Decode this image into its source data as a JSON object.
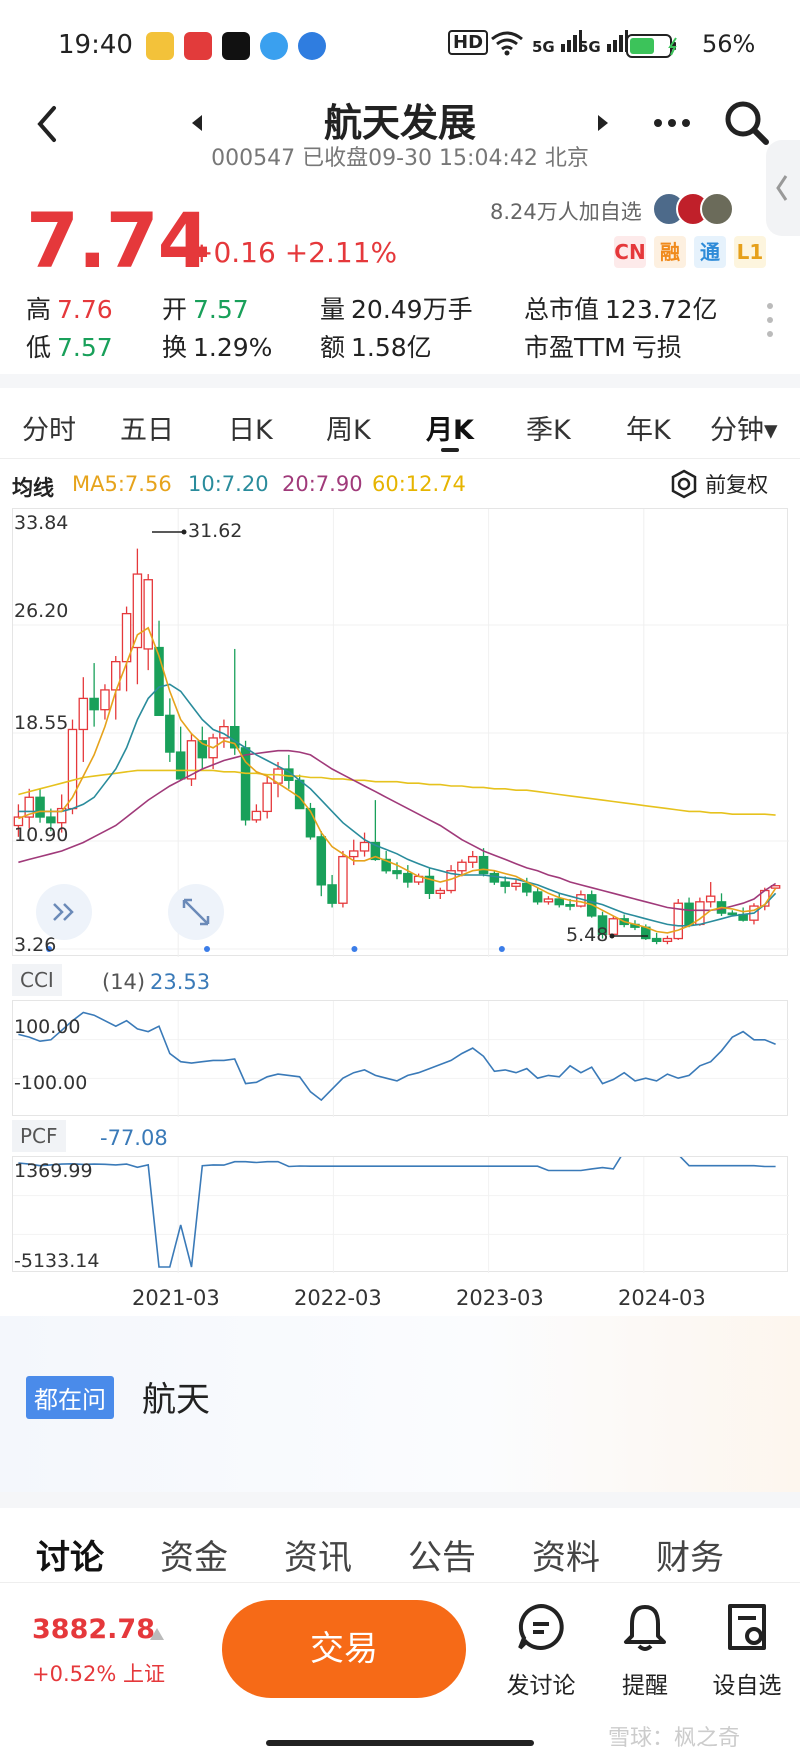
{
  "status_bar": {
    "time": "19:40",
    "battery": "56%",
    "hd": "HD",
    "net1": "5G",
    "net2": "5G"
  },
  "header": {
    "title": "航天发展",
    "subtitle": "000547 已收盘09-30 15:04:42 北京",
    "price": "7.74",
    "change": "+0.16 +2.11%",
    "watchers": "8.24万人加自选",
    "tags": [
      "CN",
      "融",
      "通",
      "L1"
    ]
  },
  "quote": {
    "high_label": "高",
    "high": "7.76",
    "low_label": "低",
    "low": "7.57",
    "open_label": "开",
    "open": "7.57",
    "turnover_label": "换",
    "turnover": "1.29%",
    "volume_label": "量",
    "volume": "20.49万手",
    "amount_label": "额",
    "amount": "1.58亿",
    "mktcap_label": "总市值",
    "mktcap": "123.72亿",
    "pe_label": "市盈TTM",
    "pe": "亏损"
  },
  "period_tabs": [
    "分时",
    "五日",
    "日K",
    "周K",
    "月K",
    "季K",
    "年K",
    "分钟▾"
  ],
  "active_period": "月K",
  "ma_legend": {
    "label": "均线",
    "ma5": "MA5:7.56",
    "ma10": "10:7.20",
    "ma20": "20:7.90",
    "ma60": "60:12.74",
    "adjust": "前复权"
  },
  "colors": {
    "up": "#e5383b",
    "down": "#19a05a",
    "ma5": "#e6a31c",
    "ma10": "#2a8c9c",
    "ma20": "#a03a7a",
    "ma60": "#e6c21e",
    "indicator": "#3a7ab8",
    "trade_btn": "#f66a17"
  },
  "chart_data": [
    {
      "type": "candlestick",
      "title": "月K",
      "y_ticks": [
        "33.84",
        "26.20",
        "18.55",
        "10.90",
        "3.26"
      ],
      "ylim": [
        3.26,
        33.84
      ],
      "x_ticks": [
        "2021-03",
        "2022-03",
        "2023-03",
        "2024-03"
      ],
      "annotations": {
        "max": "31.62",
        "min": "5.48"
      },
      "ohlc": [
        [
          12.0,
          13.5,
          11.2,
          12.6
        ],
        [
          12.6,
          14.6,
          11.8,
          14.0
        ],
        [
          14.0,
          14.6,
          12.2,
          12.6
        ],
        [
          12.6,
          13.2,
          11.6,
          12.2
        ],
        [
          12.2,
          14.2,
          11.5,
          13.2
        ],
        [
          13.2,
          19.5,
          12.8,
          18.8
        ],
        [
          18.8,
          22.5,
          16.5,
          21.0
        ],
        [
          21.0,
          23.5,
          19.0,
          20.2
        ],
        [
          20.2,
          22.0,
          19.5,
          21.6
        ],
        [
          21.6,
          24.0,
          19.5,
          23.6
        ],
        [
          23.6,
          27.5,
          21.5,
          27.0
        ],
        [
          24.6,
          31.6,
          22.0,
          29.8
        ],
        [
          24.5,
          29.8,
          23.0,
          29.4
        ],
        [
          24.6,
          26.5,
          19.8,
          19.8
        ],
        [
          19.8,
          21.0,
          16.5,
          17.2
        ],
        [
          17.2,
          19.0,
          15.2,
          15.3
        ],
        [
          15.3,
          18.5,
          14.8,
          18.0
        ],
        [
          18.0,
          19.0,
          16.0,
          16.8
        ],
        [
          16.8,
          18.5,
          16.0,
          18.2
        ],
        [
          18.2,
          19.5,
          17.5,
          19.0
        ],
        [
          19.0,
          24.5,
          17.0,
          17.5
        ],
        [
          17.5,
          18.0,
          12.0,
          12.4
        ],
        [
          12.4,
          13.5,
          12.2,
          13.0
        ],
        [
          13.0,
          15.5,
          12.5,
          15.0
        ],
        [
          15.0,
          16.5,
          14.0,
          16.0
        ],
        [
          16.0,
          17.0,
          14.6,
          15.2
        ],
        [
          15.2,
          15.6,
          13.2,
          13.2
        ],
        [
          13.2,
          13.6,
          11.0,
          11.2
        ],
        [
          11.2,
          11.6,
          7.0,
          7.8
        ],
        [
          7.8,
          8.5,
          6.2,
          6.5
        ],
        [
          6.5,
          10.2,
          6.2,
          9.8
        ],
        [
          9.8,
          11.0,
          9.2,
          10.2
        ],
        [
          10.2,
          11.5,
          9.8,
          10.8
        ],
        [
          10.8,
          13.8,
          9.5,
          9.6
        ],
        [
          9.6,
          10.2,
          8.6,
          8.8
        ],
        [
          8.8,
          9.4,
          8.2,
          8.6
        ],
        [
          8.6,
          9.2,
          7.6,
          8.0
        ],
        [
          8.0,
          8.6,
          7.8,
          8.4
        ],
        [
          8.4,
          9.0,
          6.8,
          7.2
        ],
        [
          7.2,
          7.6,
          6.8,
          7.4
        ],
        [
          7.4,
          9.2,
          7.2,
          8.8
        ],
        [
          8.8,
          9.6,
          8.4,
          9.4
        ],
        [
          9.4,
          10.2,
          9.0,
          9.8
        ],
        [
          9.8,
          10.4,
          8.4,
          8.6
        ],
        [
          8.6,
          8.8,
          7.8,
          8.0
        ],
        [
          8.0,
          8.4,
          7.2,
          7.7
        ],
        [
          7.7,
          8.2,
          7.4,
          7.9
        ],
        [
          7.9,
          8.3,
          7.0,
          7.3
        ],
        [
          7.3,
          7.6,
          6.4,
          6.6
        ],
        [
          6.6,
          7.0,
          6.4,
          6.8
        ],
        [
          6.8,
          7.2,
          6.2,
          6.4
        ],
        [
          6.4,
          6.8,
          6.0,
          6.3
        ],
        [
          6.3,
          7.4,
          6.2,
          7.1
        ],
        [
          7.1,
          7.4,
          5.48,
          5.6
        ],
        [
          5.6,
          5.9,
          4.0,
          4.3
        ],
        [
          4.3,
          5.6,
          4.2,
          5.4
        ],
        [
          5.4,
          5.7,
          4.8,
          5.0
        ],
        [
          5.0,
          5.3,
          4.6,
          4.8
        ],
        [
          4.8,
          5.0,
          3.9,
          4.0
        ],
        [
          4.0,
          4.4,
          3.6,
          3.8
        ],
        [
          3.8,
          4.2,
          3.6,
          4.0
        ],
        [
          4.0,
          6.8,
          3.9,
          6.5
        ],
        [
          6.5,
          6.9,
          4.8,
          5.0
        ],
        [
          5.0,
          6.9,
          4.9,
          6.6
        ],
        [
          6.6,
          8.0,
          6.2,
          7.0
        ],
        [
          6.6,
          7.2,
          5.6,
          5.8
        ],
        [
          5.8,
          6.0,
          5.6,
          5.7
        ],
        [
          5.7,
          6.2,
          5.2,
          5.3
        ],
        [
          5.3,
          6.5,
          5.0,
          6.3
        ],
        [
          6.3,
          7.6,
          6.0,
          7.4
        ],
        [
          7.57,
          7.76,
          7.57,
          7.74
        ]
      ],
      "ma5": [
        12.5,
        12.8,
        13.0,
        13.0,
        13.0,
        14.0,
        15.5,
        17.0,
        19.0,
        21.5,
        23.5,
        25.5,
        26.0,
        24.0,
        21.5,
        19.5,
        18.5,
        17.8,
        17.5,
        18.0,
        17.8,
        16.5,
        15.8,
        15.5,
        15.0,
        14.5,
        14.0,
        13.0,
        11.5,
        10.5,
        10.0,
        9.5,
        9.5,
        9.8,
        9.5,
        9.2,
        8.8,
        8.4,
        8.2,
        8.0,
        8.2,
        8.5,
        8.8,
        8.9,
        8.8,
        8.6,
        8.4,
        8.0,
        7.6,
        7.2,
        6.9,
        6.7,
        6.6,
        6.4,
        6.0,
        5.6,
        5.2,
        5.0,
        4.8,
        4.5,
        4.4,
        4.6,
        4.9,
        5.4,
        6.0,
        6.2,
        6.1,
        5.9,
        6.0,
        6.4,
        7.56
      ],
      "ma10": [
        13.0,
        13.0,
        13.0,
        13.0,
        13.0,
        13.2,
        13.5,
        14.0,
        15.0,
        16.0,
        17.5,
        19.5,
        21.0,
        21.8,
        22.0,
        21.5,
        20.5,
        19.5,
        18.8,
        18.5,
        18.0,
        17.5,
        17.0,
        16.6,
        16.2,
        15.8,
        15.2,
        14.6,
        13.8,
        13.0,
        12.2,
        11.6,
        11.0,
        10.6,
        10.3,
        10.0,
        9.6,
        9.3,
        9.0,
        8.8,
        8.6,
        8.5,
        8.5,
        8.5,
        8.4,
        8.3,
        8.2,
        8.0,
        7.8,
        7.5,
        7.2,
        7.0,
        6.8,
        6.6,
        6.4,
        6.1,
        5.8,
        5.6,
        5.4,
        5.2,
        5.0,
        4.9,
        4.9,
        5.0,
        5.2,
        5.4,
        5.6,
        5.7,
        5.8,
        6.4,
        7.2
      ],
      "ma20": [
        9.4,
        9.6,
        9.8,
        10.0,
        10.2,
        10.5,
        10.8,
        11.2,
        11.6,
        12.0,
        12.6,
        13.2,
        13.8,
        14.3,
        14.8,
        15.2,
        15.6,
        16.0,
        16.3,
        16.6,
        16.8,
        17.0,
        17.1,
        17.2,
        17.3,
        17.3,
        17.2,
        17.0,
        16.5,
        16.0,
        15.6,
        15.2,
        14.8,
        14.4,
        14.0,
        13.6,
        13.2,
        12.8,
        12.4,
        12.0,
        11.5,
        11.0,
        10.6,
        10.2,
        9.9,
        9.6,
        9.3,
        9.0,
        8.8,
        8.5,
        8.3,
        8.0,
        7.8,
        7.6,
        7.4,
        7.2,
        7.0,
        6.8,
        6.6,
        6.4,
        6.2,
        6.1,
        6.0,
        6.0,
        6.0,
        6.1,
        6.3,
        6.5,
        6.8,
        7.4,
        7.9
      ],
      "ma60": [
        14.2,
        14.4,
        14.6,
        14.8,
        15.0,
        15.2,
        15.4,
        15.5,
        15.6,
        15.7,
        15.8,
        15.9,
        15.9,
        15.9,
        15.9,
        15.9,
        15.9,
        15.9,
        15.9,
        15.8,
        15.8,
        15.7,
        15.7,
        15.6,
        15.6,
        15.5,
        15.5,
        15.4,
        15.4,
        15.3,
        15.3,
        15.2,
        15.2,
        15.1,
        15.1,
        15.1,
        15.0,
        15.0,
        14.9,
        14.9,
        14.8,
        14.8,
        14.7,
        14.7,
        14.6,
        14.6,
        14.5,
        14.5,
        14.4,
        14.3,
        14.2,
        14.1,
        14.0,
        13.9,
        13.8,
        13.7,
        13.6,
        13.5,
        13.4,
        13.3,
        13.2,
        13.1,
        13.0,
        13.0,
        12.9,
        12.9,
        12.8,
        12.8,
        12.8,
        12.8,
        12.74
      ]
    },
    {
      "type": "line",
      "title": "CCI",
      "param": "(14)",
      "value": "23.53",
      "y_ticks": [
        "100.00",
        "-100.00"
      ],
      "ylim": [
        -220,
        160
      ],
      "values": [
        60,
        50,
        35,
        40,
        75,
        110,
        140,
        130,
        110,
        90,
        110,
        80,
        70,
        90,
        -10,
        -40,
        -45,
        -40,
        -35,
        -35,
        -30,
        -120,
        -115,
        -95,
        -85,
        -90,
        -95,
        -150,
        -180,
        -140,
        -100,
        -80,
        -70,
        -90,
        -100,
        -110,
        -90,
        -80,
        -65,
        -50,
        -35,
        -10,
        10,
        -20,
        -75,
        -70,
        -80,
        -65,
        -100,
        -90,
        -95,
        -55,
        -80,
        -60,
        -120,
        -105,
        -80,
        -110,
        -100,
        -110,
        -85,
        -100,
        -90,
        -55,
        -40,
        0,
        50,
        70,
        40,
        40,
        23.53
      ]
    },
    {
      "type": "line",
      "title": "PCF",
      "value": "-77.08",
      "y_ticks": [
        "1369.99",
        "-5133.14"
      ],
      "ylim": [
        -5133.14,
        1369.99
      ],
      "values": [
        1369.99,
        1300,
        1200,
        1250,
        1300,
        1320,
        1280,
        1300,
        1290,
        1250,
        1300,
        1100,
        1250,
        -5133.14,
        -5133.14,
        -2500,
        -5133.14,
        1200,
        1250,
        1240,
        1450,
        1450,
        1400,
        1450,
        1450,
        1150,
        1180,
        1170,
        1170,
        1170,
        1170,
        1170,
        1170,
        1170,
        1170,
        1170,
        1170,
        1170,
        1170,
        1170,
        1170,
        1170,
        1170,
        1170,
        1170,
        1170,
        1170,
        1170,
        1170,
        900,
        900,
        900,
        900,
        1000,
        1080,
        1000,
        2100,
        2100,
        2050,
        1900,
        2000,
        1900,
        1200,
        1200,
        1200,
        1200,
        1200,
        1200,
        1200,
        1150,
        1150
      ]
    }
  ],
  "ask": {
    "badge": "都在问",
    "query": "航天"
  },
  "content_tabs": [
    "讨论",
    "资金",
    "资讯",
    "公告",
    "资料",
    "财务"
  ],
  "footer": {
    "index_value": "3882.78",
    "index_change": "+0.52% 上证",
    "trade": "交易",
    "discuss": "发讨论",
    "remind": "提醒",
    "watchlist": "设自选",
    "watermark": "雪球：枫之奇"
  }
}
